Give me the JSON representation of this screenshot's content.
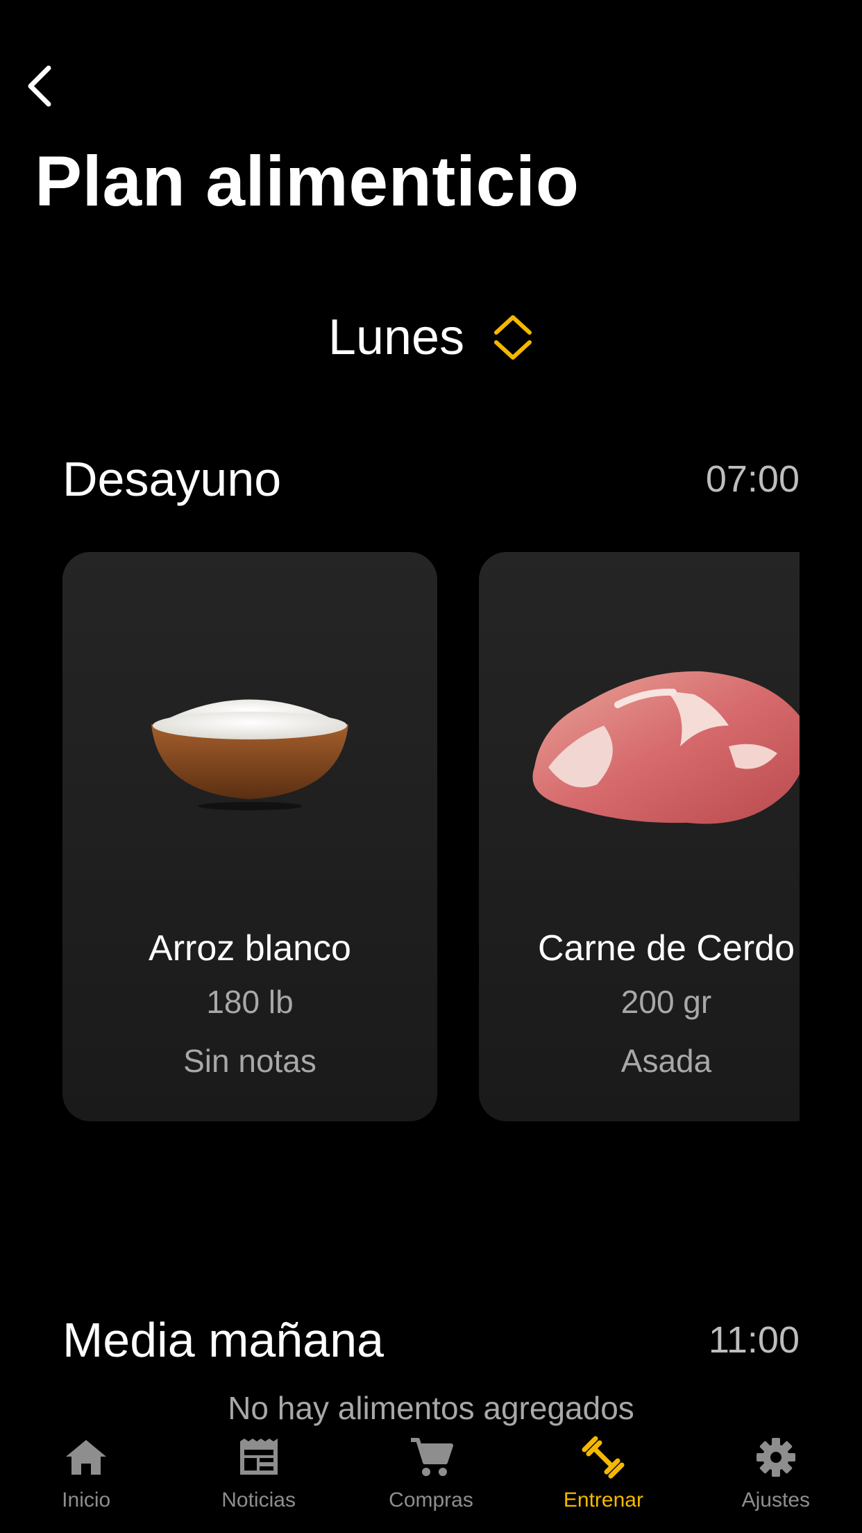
{
  "header": {
    "back_icon": "chevron-left-icon",
    "title": "Plan alimenticio"
  },
  "day_selector": {
    "value": "Lunes",
    "icon": "chevron-up-down-icon",
    "accent": "#F5B800"
  },
  "meals": [
    {
      "name": "Desayuno",
      "time": "07:00",
      "foods": [
        {
          "name": "Arroz blanco",
          "quantity": "180 lb",
          "note": "Sin notas",
          "image": "rice-bowl"
        },
        {
          "name": "Carne de Cerdo",
          "quantity": "200 gr",
          "note": "Asada",
          "image": "pork-meat"
        }
      ]
    },
    {
      "name": "Media mañana",
      "time": "11:00",
      "empty_message": "No hay alimentos agregados"
    }
  ],
  "tabbar": {
    "accent": "#F5B800",
    "inactive_color": "#8E8E8E",
    "items": [
      {
        "label": "Inicio",
        "icon": "home-icon",
        "active": false
      },
      {
        "label": "Noticias",
        "icon": "newspaper-icon",
        "active": false
      },
      {
        "label": "Compras",
        "icon": "cart-icon",
        "active": false
      },
      {
        "label": "Entrenar",
        "icon": "dumbbell-icon",
        "active": true
      },
      {
        "label": "Ajustes",
        "icon": "gear-icon",
        "active": false
      }
    ]
  }
}
